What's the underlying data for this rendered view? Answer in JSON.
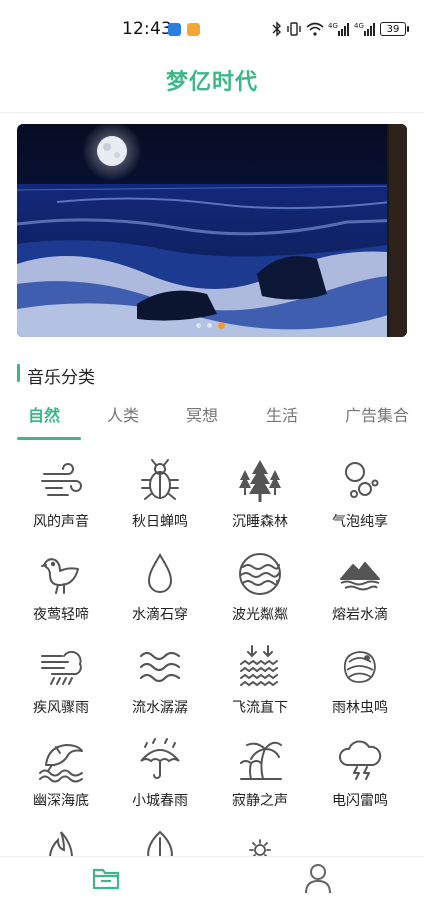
{
  "status_bar": {
    "time": "12:43",
    "battery": "39",
    "signal_labels": [
      "4G",
      "4G"
    ]
  },
  "header": {
    "title": "梦亿时代"
  },
  "banner": {
    "dots": 3,
    "active_dot": 2
  },
  "section": {
    "title": "音乐分类"
  },
  "tabs": [
    {
      "label": "自然",
      "active": true
    },
    {
      "label": "人类",
      "active": false
    },
    {
      "label": "冥想",
      "active": false
    },
    {
      "label": "生活",
      "active": false
    },
    {
      "label": "广告集合",
      "active": false
    }
  ],
  "sounds": [
    {
      "label": "风的声音",
      "icon": "wind-icon"
    },
    {
      "label": "秋日蝉鸣",
      "icon": "cicada-icon"
    },
    {
      "label": "沉睡森林",
      "icon": "forest-icon"
    },
    {
      "label": "气泡纯享",
      "icon": "bubbles-icon"
    },
    {
      "label": "夜莺轻啼",
      "icon": "bird-icon"
    },
    {
      "label": "水滴石穿",
      "icon": "water-drop-icon"
    },
    {
      "label": "波光粼粼",
      "icon": "wave-circle-icon"
    },
    {
      "label": "熔岩水滴",
      "icon": "lava-icon"
    },
    {
      "label": "疾风骤雨",
      "icon": "windy-rain-icon"
    },
    {
      "label": "流水潺潺",
      "icon": "stream-icon"
    },
    {
      "label": "飞流直下",
      "icon": "waterfall-icon"
    },
    {
      "label": "雨林虫鸣",
      "icon": "rainforest-bug-icon"
    },
    {
      "label": "幽深海底",
      "icon": "dolphin-icon"
    },
    {
      "label": "小城春雨",
      "icon": "umbrella-rain-icon"
    },
    {
      "label": "寂静之声",
      "icon": "palm-tree-icon"
    },
    {
      "label": "电闪雷鸣",
      "icon": "thunder-icon"
    },
    {
      "label": "",
      "icon": "fire-icon"
    },
    {
      "label": "",
      "icon": "leaf-icon"
    },
    {
      "label": "",
      "icon": "sun-icon"
    },
    {
      "label": "",
      "icon": "empty-icon"
    }
  ],
  "bottom_nav": [
    {
      "name": "music-library",
      "icon": "folder-icon",
      "active": true
    },
    {
      "name": "profile",
      "icon": "user-icon",
      "active": false
    }
  ],
  "colors": {
    "accent": "#3cb888",
    "indicator": "#f39a2d",
    "icon_stroke": "#555555"
  }
}
